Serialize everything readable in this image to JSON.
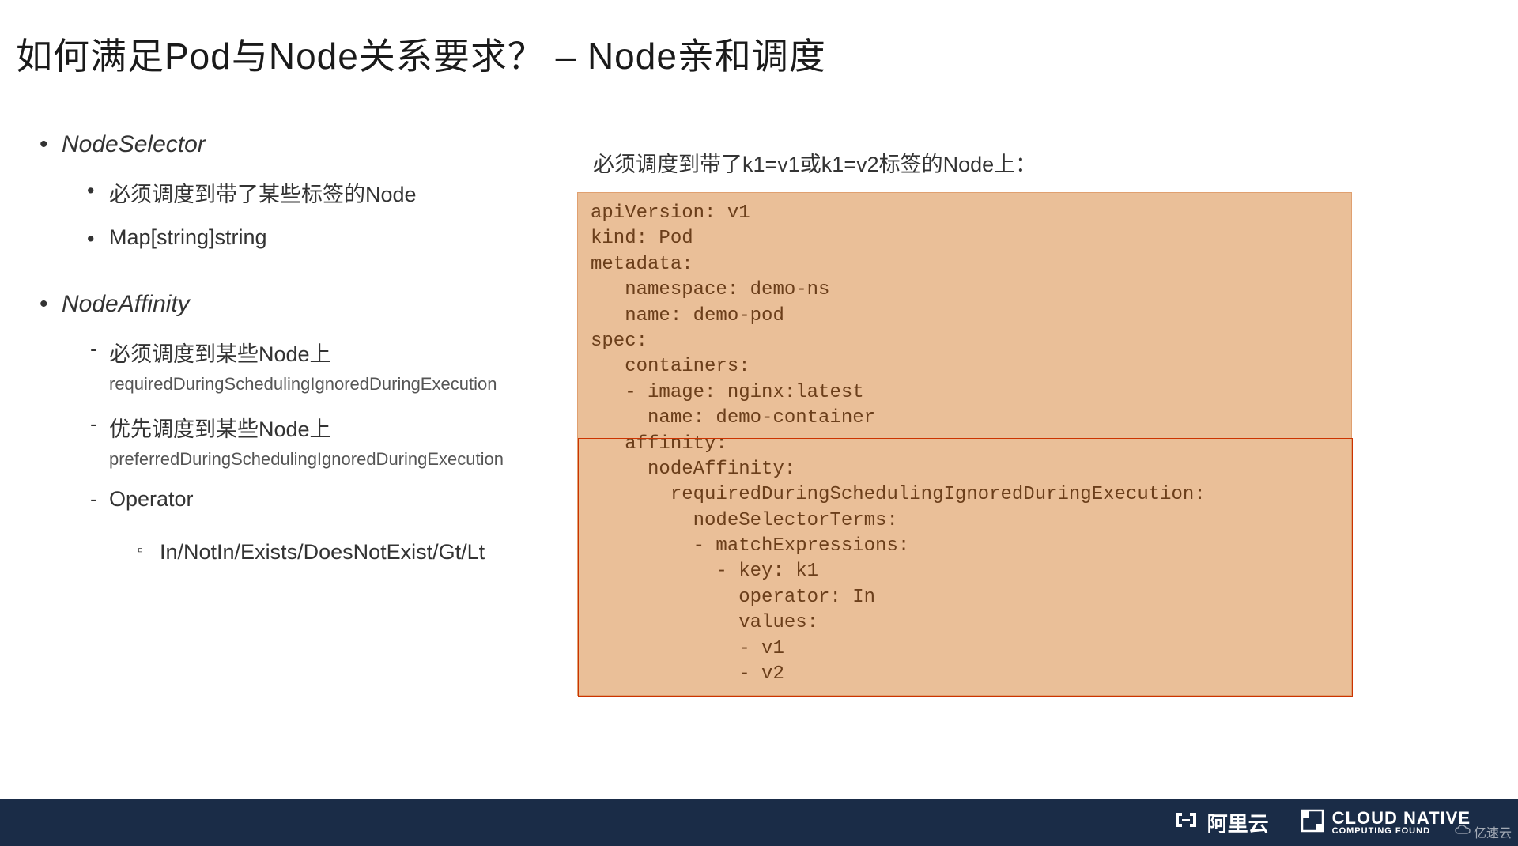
{
  "title": "如何满足Pod与Node关系要求？ – Node亲和调度",
  "left": {
    "section1": {
      "heading": "NodeSelector",
      "items": [
        "必须调度到带了某些标签的Node",
        "Map[string]string"
      ]
    },
    "section2": {
      "heading": "NodeAffinity",
      "items": [
        {
          "text": "必须调度到某些Node上",
          "sub": "requiredDuringSchedulingIgnoredDuringExecution"
        },
        {
          "text": "优先调度到某些Node上",
          "sub": "preferredDuringSchedulingIgnoredDuringExecution"
        },
        {
          "text": "Operator",
          "sub_l3": "In/NotIn/Exists/DoesNotExist/Gt/Lt"
        }
      ]
    }
  },
  "right": {
    "heading": "必须调度到带了k1=v1或k1=v2标签的Node上：",
    "code": "apiVersion: v1\nkind: Pod\nmetadata:\n   namespace: demo-ns\n   name: demo-pod\nspec:\n   containers:\n   - image: nginx:latest\n     name: demo-container\n   affinity:\n     nodeAffinity:\n       requiredDuringSchedulingIgnoredDuringExecution:\n         nodeSelectorTerms:\n         - matchExpressions:\n           - key: k1\n             operator: In\n             values:\n             - v1\n             - v2"
  },
  "footer": {
    "brand1": "阿里云",
    "brand2_main": "CLOUD NATIVE",
    "brand2_sub": "COMPUTING FOUND",
    "watermark": "亿速云"
  }
}
